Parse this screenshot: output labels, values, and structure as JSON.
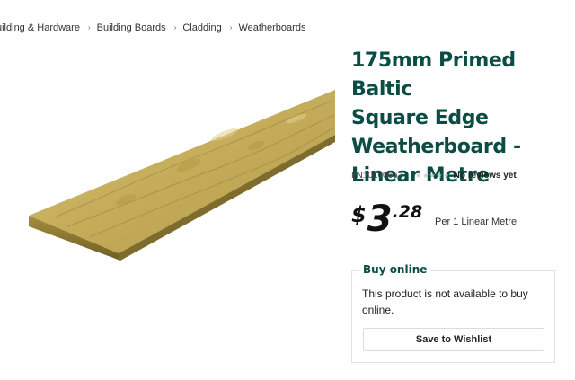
{
  "breadcrumb": {
    "items": [
      {
        "label": "uilding & Hardware"
      },
      {
        "label": "Building Boards"
      },
      {
        "label": "Cladding"
      },
      {
        "label": "Weatherboards"
      }
    ],
    "separator": "›"
  },
  "product": {
    "title_lines": [
      "175mm Primed Baltic",
      "Square Edge",
      "Weatherboard -",
      "Linear Metre"
    ],
    "item_number": "I/N: 0100662",
    "reviews_text": "No reviews yet",
    "rating_stars": 0,
    "price": {
      "symbol": "$",
      "dollars": "3",
      "cents": ".28",
      "unit": "Per 1 Linear Metre"
    },
    "image_icon": "timber-weatherboard-image"
  },
  "buy_online": {
    "title": "Buy online",
    "message": "This product is not available to buy online.",
    "wishlist_label": "Save to Wishlist"
  },
  "colors": {
    "brand_green": "#0b4d44",
    "timber_light": "#c8b266",
    "timber_dark": "#8d7a2e"
  }
}
